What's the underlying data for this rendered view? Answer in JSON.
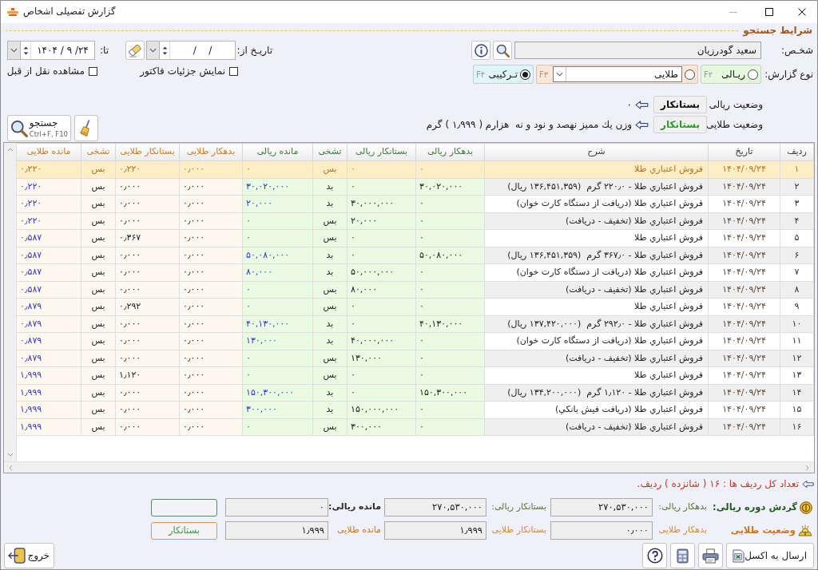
{
  "window": {
    "title": "گزارش تفصیلی اشخاص"
  },
  "search": {
    "title": "شرایط جستجو",
    "person": {
      "label": "شخـص:",
      "value": "سعید گودرزیان"
    },
    "date_from": {
      "label": "تاریـخ از:",
      "value": "/    /"
    },
    "date_to": {
      "label": "تا:",
      "value": "۱۴۰۴ / ۹ /۲۴"
    },
    "checkboxes": [
      {
        "label": "نمایش جزئیات فاکتور",
        "checked": false
      },
      {
        "label": "مشاهده نقل از قبل",
        "checked": false
      }
    ],
    "report_type": {
      "label": "نوع گزارش:",
      "options": [
        {
          "kind": "radio",
          "label": "ریـالی",
          "shortcut": "F۲",
          "selected": false,
          "color": "#e6f8de"
        },
        {
          "kind": "combo",
          "label": "طلایی",
          "shortcut": "F۳",
          "selected": false,
          "color": "#fde6d5"
        },
        {
          "kind": "radio",
          "label": "تـرکیبی",
          "shortcut": "F۴",
          "selected": true,
          "color": "#dff5f8"
        }
      ]
    },
    "balances": [
      {
        "label": "وضعیت ریالی",
        "status": "بستانکار",
        "color": "#111111",
        "text": "۰"
      },
      {
        "label": "وضعیت طلایی",
        "status": "بستانکار",
        "color": "#2e9a2e",
        "text": "وزن يك ممیز نهصد و نود و نه  هزارم ( ۱٫۹۹۹ ) گرم"
      }
    ],
    "search_button": {
      "label": "جستجو",
      "shortcut": "Ctrl+F, F10"
    }
  },
  "table": {
    "column_groups": [
      {
        "kind": "general",
        "columns": [
          {
            "label": "ردیف",
            "kind": "number"
          },
          {
            "label": "تاریخ",
            "kind": "date"
          },
          {
            "label": "شرح",
            "kind": "text"
          }
        ]
      },
      {
        "kind": "rial",
        "columns": [
          {
            "label": "بدهکار ریالی",
            "kind": "amount"
          },
          {
            "label": "بستانکار ریالی",
            "kind": "amount"
          },
          {
            "label": "تشخی",
            "kind": "flag"
          },
          {
            "label": "مانده ریالی",
            "kind": "balance"
          }
        ]
      },
      {
        "kind": "gold",
        "columns": [
          {
            "label": "بدهکار طلایی",
            "kind": "amount"
          },
          {
            "label": "بستانکار طلایی",
            "kind": "amount"
          },
          {
            "label": "تشخی",
            "kind": "flag"
          },
          {
            "label": "مانده طلایی",
            "kind": "balance"
          }
        ]
      }
    ],
    "rows": [
      {
        "selected": true,
        "cells": [
          "۱",
          "۱۴۰۴/۰۹/۲۴",
          "فروش اعتباري طلا",
          "۰",
          "۰",
          "بس",
          "۰",
          "۰٫۰۰۰",
          "۰٫۲۲۰",
          "بس",
          "۰٫۲۲۰"
        ]
      },
      {
        "selected": false,
        "cells": [
          "۲",
          "۱۴۰۴/۰۹/۲۴",
          "فروش اعتباري طلا - ۲۲۰٫۰ گرم  (۱۳۶,۴۵۱,۳۵۹ ریال)",
          "۳۰,۰۲۰,۰۰۰",
          "۰",
          "بد",
          "۳۰,۰۲۰,۰۰۰",
          "۰٫۰۰۰",
          "۰٫۰۰۰",
          "بس",
          "۰٫۲۲۰"
        ]
      },
      {
        "selected": false,
        "cells": [
          "۳",
          "۱۴۰۴/۰۹/۲۴",
          "فروش اعتباري طلا (دریافت از دستگاه کارت خوان)",
          "۰",
          "۳۰,۰۰۰,۰۰۰",
          "بد",
          "۲۰,۰۰۰",
          "۰٫۰۰۰",
          "۰٫۰۰۰",
          "بس",
          "۰٫۲۲۰"
        ]
      },
      {
        "selected": false,
        "cells": [
          "۴",
          "۱۴۰۴/۰۹/۲۴",
          "فروش اعتباري طلا (تخفیف - دریافت)",
          "۰",
          "۲۰,۰۰۰",
          "بس",
          "۰",
          "۰٫۰۰۰",
          "۰٫۰۰۰",
          "بس",
          "۰٫۲۲۰"
        ]
      },
      {
        "selected": false,
        "cells": [
          "۵",
          "۱۴۰۴/۰۹/۲۴",
          "فروش اعتباري طلا",
          "۰",
          "۰",
          "بس",
          "۰",
          "۰٫۰۰۰",
          "۰٫۳۶۷",
          "بس",
          "۰٫۵۸۷"
        ]
      },
      {
        "selected": false,
        "cells": [
          "۶",
          "۱۴۰۴/۰۹/۲۴",
          "فروش اعتباري طلا - ۳۶۷٫۰ گرم  (۱۳۶,۴۵۱,۳۵۹ ریال)",
          "۵۰,۰۸۰,۰۰۰",
          "۰",
          "بد",
          "۵۰,۰۸۰,۰۰۰",
          "۰٫۰۰۰",
          "۰٫۰۰۰",
          "بس",
          "۰٫۵۸۷"
        ]
      },
      {
        "selected": false,
        "cells": [
          "۷",
          "۱۴۰۴/۰۹/۲۴",
          "فروش اعتباري طلا (دریافت از دستگاه کارت خوان)",
          "۰",
          "۵۰,۰۰۰,۰۰۰",
          "بد",
          "۸۰,۰۰۰",
          "۰٫۰۰۰",
          "۰٫۰۰۰",
          "بس",
          "۰٫۵۸۷"
        ]
      },
      {
        "selected": false,
        "cells": [
          "۸",
          "۱۴۰۴/۰۹/۲۴",
          "فروش اعتباري طلا (تخفیف - دریافت)",
          "۰",
          "۸۰,۰۰۰",
          "بس",
          "۰",
          "۰٫۰۰۰",
          "۰٫۰۰۰",
          "بس",
          "۰٫۵۸۷"
        ]
      },
      {
        "selected": false,
        "cells": [
          "۹",
          "۱۴۰۴/۰۹/۲۴",
          "فروش اعتباري طلا",
          "۰",
          "۰",
          "بس",
          "۰",
          "۰٫۰۰۰",
          "۰٫۲۹۲",
          "بس",
          "۰٫۸۷۹"
        ]
      },
      {
        "selected": false,
        "cells": [
          "۱۰",
          "۱۴۰۴/۰۹/۲۴",
          "فروش اعتباري طلا - ۲۹۲٫۰ گرم  (۱۳۷,۴۲۰,۰۰۰ ریال)",
          "۴۰,۱۳۰,۰۰۰",
          "۰",
          "بد",
          "۴۰,۱۳۰,۰۰۰",
          "۰٫۰۰۰",
          "۰٫۰۰۰",
          "بس",
          "۰٫۸۷۹"
        ]
      },
      {
        "selected": false,
        "cells": [
          "۱۱",
          "۱۴۰۴/۰۹/۲۴",
          "فروش اعتباري طلا (دریافت از دستگاه کارت خوان)",
          "۰",
          "۴۰,۰۰۰,۰۰۰",
          "بد",
          "۱۳۰,۰۰۰",
          "۰٫۰۰۰",
          "۰٫۰۰۰",
          "بس",
          "۰٫۸۷۹"
        ]
      },
      {
        "selected": false,
        "cells": [
          "۱۲",
          "۱۴۰۴/۰۹/۲۴",
          "فروش اعتباري طلا (تخفیف - دریافت)",
          "۰",
          "۱۳۰,۰۰۰",
          "بس",
          "۰",
          "۰٫۰۰۰",
          "۰٫۰۰۰",
          "بس",
          "۰٫۸۷۹"
        ]
      },
      {
        "selected": false,
        "cells": [
          "۱۳",
          "۱۴۰۴/۰۹/۲۴",
          "فروش اعتباري طلا",
          "۰",
          "۰",
          "بس",
          "۰",
          "۰٫۰۰۰",
          "۱٫۱۲۰",
          "بس",
          "۱٫۹۹۹"
        ]
      },
      {
        "selected": false,
        "cells": [
          "۱۴",
          "۱۴۰۴/۰۹/۲۴",
          "فروش اعتباري طلا - ۱٫۱۲۰ گرم  (۱۳۴,۲۰۰,۰۰۰ ریال)",
          "۱۵۰,۳۰۰,۰۰۰",
          "۰",
          "بد",
          "۱۵۰,۳۰۰,۰۰۰",
          "۰٫۰۰۰",
          "۰٫۰۰۰",
          "بس",
          "۱٫۹۹۹"
        ]
      },
      {
        "selected": false,
        "cells": [
          "۱۵",
          "۱۴۰۴/۰۹/۲۴",
          "فروش اعتباري طلا (دریافت فیش بانکي)",
          "۰",
          "۱۵۰,۰۰۰,۰۰۰",
          "بد",
          "۳۰۰,۰۰۰",
          "۰٫۰۰۰",
          "۰٫۰۰۰",
          "بس",
          "۱٫۹۹۹"
        ]
      },
      {
        "selected": false,
        "cells": [
          "۱۶",
          "۱۴۰۴/۰۹/۲۴",
          "فروش اعتباري طلا (تخفیف - دریافت)",
          "۰",
          "۳۰۰,۰۰۰",
          "بس",
          "۰",
          "۰٫۰۰۰",
          "۰٫۰۰۰",
          "بس",
          "۱٫۹۹۹"
        ]
      }
    ]
  },
  "row_count": "تعداد کل ردیف ها : ۱۶ ( شانزده ) ردیف.",
  "totals": [
    {
      "kind": "rial",
      "title": "گردش دوره ریالی:",
      "debit_label": "بدهکار ریالی:",
      "debit": "۲۷۰,۵۳۰,۰۰۰",
      "credit_label": "بستانکار ریالی:",
      "credit": "۲۷۰,۵۳۰,۰۰۰",
      "balance_label": "مانده ریالی:",
      "balance": "۰"
    },
    {
      "kind": "gold",
      "title": "وضعیت طلایی",
      "debit_label": "بدهکار طلایی",
      "debit": "۰٫۰۰۰",
      "credit_label": "بستانکار طلایی",
      "credit": "۱٫۹۹۹",
      "balance_label": "مانده طلایی",
      "balance": "۱٫۹۹۹",
      "status": "بستانکار"
    }
  ],
  "buttons": [
    {
      "kind": "excel",
      "label": "ارسال به اکسل"
    },
    {
      "kind": "print"
    },
    {
      "kind": "calculator"
    },
    {
      "kind": "help"
    }
  ],
  "exit_button": {
    "label": "خروج"
  }
}
